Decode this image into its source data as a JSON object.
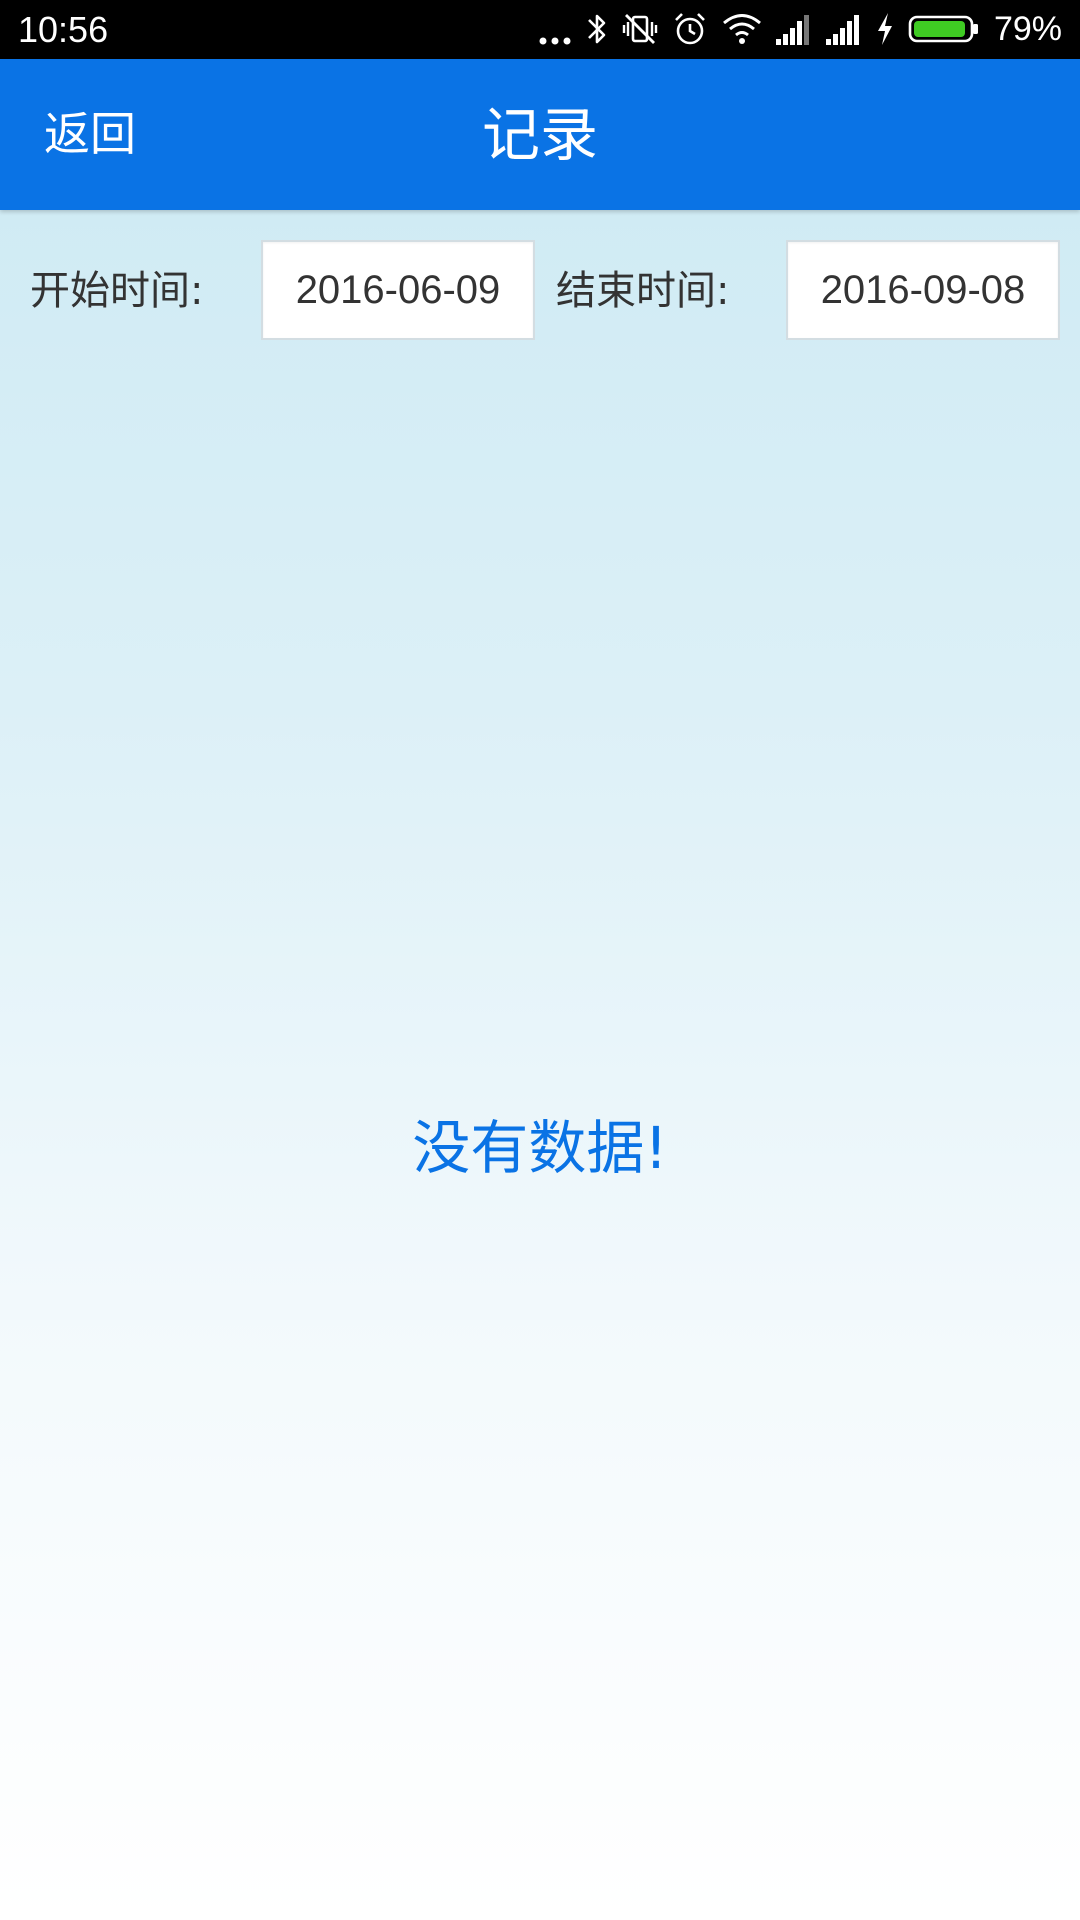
{
  "status_bar": {
    "time": "10:56",
    "battery_percent": "79%",
    "icons": [
      "more-dots-icon",
      "bluetooth-icon",
      "vibrate-off-icon",
      "alarm-icon",
      "wifi-icon",
      "signal-icon",
      "signal-icon",
      "charging-icon",
      "battery-icon"
    ],
    "battery_color": "#3fcb23"
  },
  "app_bar": {
    "back_label": "返回",
    "title": "记录",
    "color": "#0a73e5"
  },
  "filter": {
    "start_label": "开始时间:",
    "start_value": "2016-06-09",
    "end_label": "结束时间:",
    "end_value": "2016-09-08"
  },
  "empty_state": {
    "message": "没有数据!",
    "color": "#0a73e5"
  }
}
